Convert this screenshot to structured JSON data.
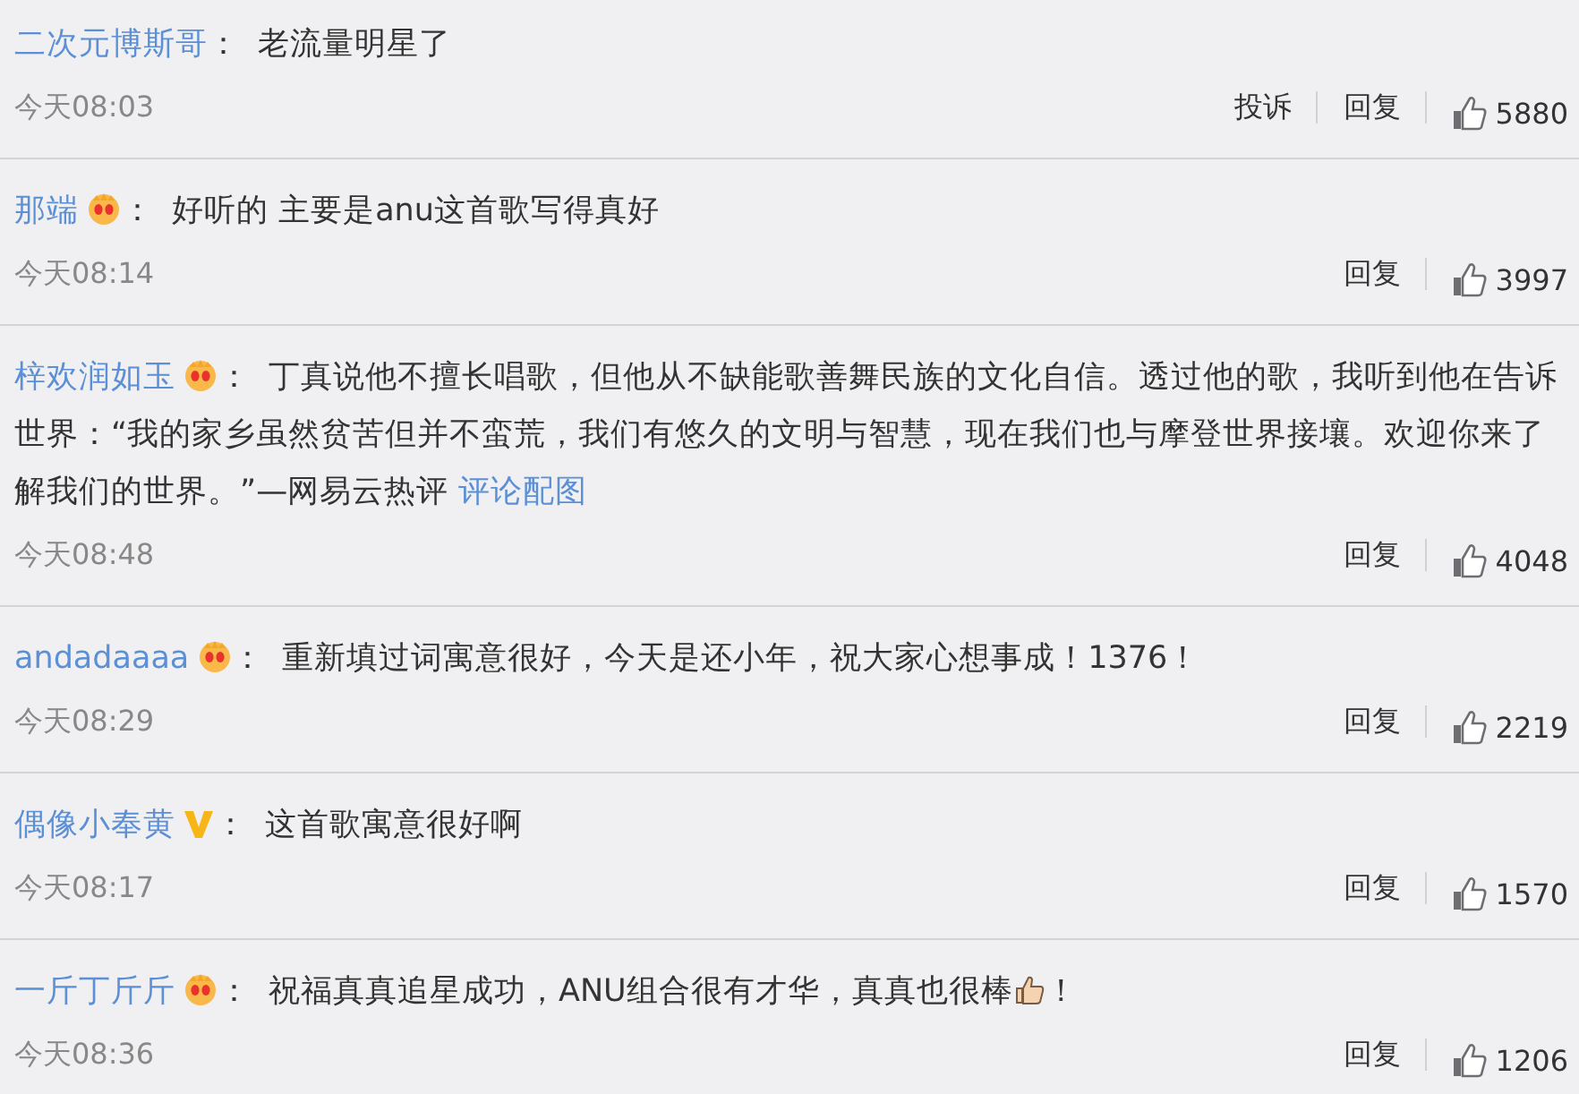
{
  "comments": [
    {
      "user": "二次元博斯哥",
      "crown_badge": false,
      "v_badge": false,
      "sep": "：",
      "content": [
        {
          "kind": "text",
          "text": "老流量明星了"
        }
      ],
      "time": "今天08:03",
      "actions": [
        "投诉",
        "回复"
      ],
      "likes": "5880"
    },
    {
      "user": "那端",
      "crown_badge": true,
      "v_badge": false,
      "sep": "：",
      "content": [
        {
          "kind": "text",
          "text": "好听的 主要是anu这首歌写得真好"
        }
      ],
      "time": "今天08:14",
      "actions": [
        "回复"
      ],
      "likes": "3997"
    },
    {
      "user": "梓欢润如玉",
      "crown_badge": true,
      "v_badge": false,
      "sep": "：",
      "content": [
        {
          "kind": "text",
          "text": "丁真说他不擅长唱歌，但他从不缺能歌善舞民族的文化自信。透过他的歌，我听到他在告诉世界：“我的家乡虽然贫苦但并不蛮荒，我们有悠久的文明与智慧，现在我们也与摩登世界接壤。欢迎你来了解我们的世界。”—网易云热评 "
        },
        {
          "kind": "link",
          "text": "评论配图"
        }
      ],
      "time": "今天08:48",
      "actions": [
        "回复"
      ],
      "likes": "4048"
    },
    {
      "user": "andadaaaa",
      "crown_badge": true,
      "v_badge": false,
      "sep": "：",
      "content": [
        {
          "kind": "text",
          "text": "重新填过词寓意很好，今天是还小年，祝大家心想事成！1376！"
        }
      ],
      "time": "今天08:29",
      "actions": [
        "回复"
      ],
      "likes": "2219"
    },
    {
      "user": "偶像小奉黄",
      "crown_badge": false,
      "v_badge": true,
      "sep": "：",
      "content": [
        {
          "kind": "text",
          "text": "这首歌寓意很好啊"
        }
      ],
      "time": "今天08:17",
      "actions": [
        "回复"
      ],
      "likes": "1570"
    },
    {
      "user": "一斤丁斤斤",
      "crown_badge": true,
      "v_badge": false,
      "sep": "：",
      "content": [
        {
          "kind": "text",
          "text": "祝福真真追星成功，ANU组合很有才华，真真也很棒"
        },
        {
          "kind": "emoji"
        },
        {
          "kind": "text",
          "text": "！"
        }
      ],
      "time": "今天08:36",
      "actions": [
        "回复"
      ],
      "likes": "1206"
    }
  ]
}
